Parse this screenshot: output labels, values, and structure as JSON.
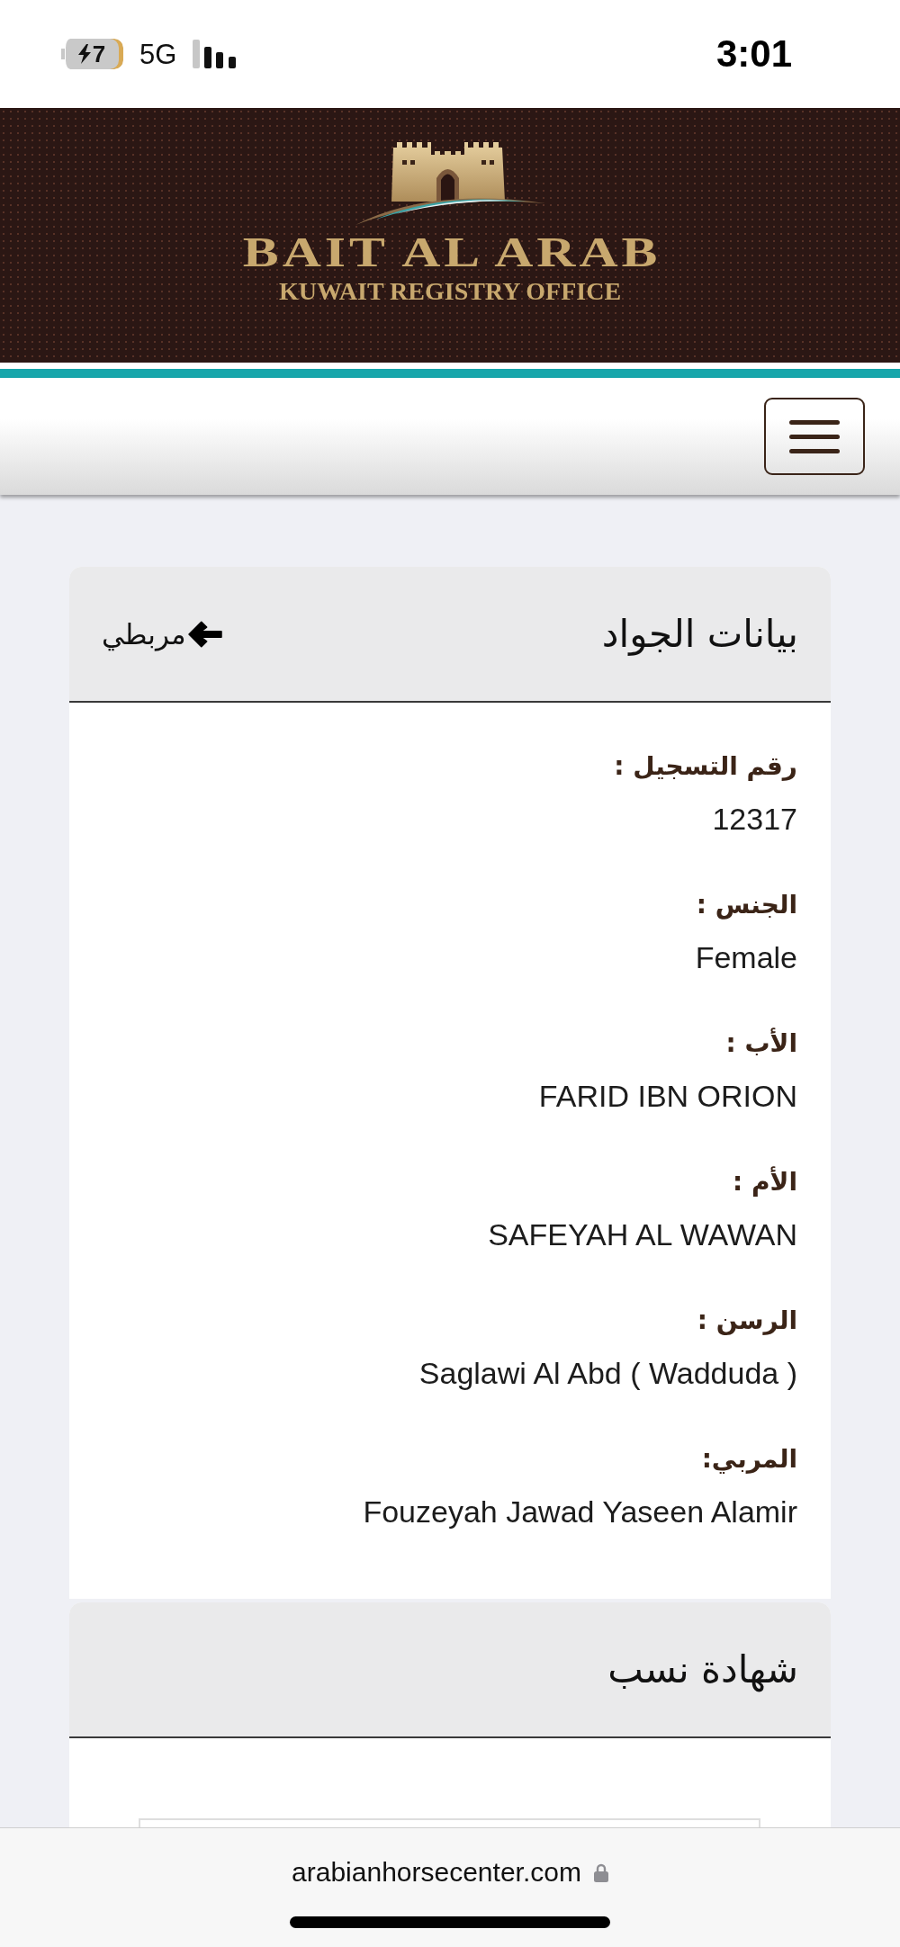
{
  "status_bar": {
    "battery": {
      "percent": "7",
      "charging": true
    },
    "network": "5G",
    "time": "3:01"
  },
  "header": {
    "title": "BAIT AL ARAB",
    "subtitle": "KUWAIT REGISTRY OFFICE"
  },
  "horse_card": {
    "title": "بيانات الجواد",
    "back_link": "مربطي",
    "fields": [
      {
        "label": "رقم التسجيل :",
        "value": "12317"
      },
      {
        "label": "الجنس :",
        "value": "Female"
      },
      {
        "label": "الأب :",
        "value": "FARID IBN ORION"
      },
      {
        "label": "الأم :",
        "value": "SAFEYAH AL WAWAN"
      },
      {
        "label": "الرسن :",
        "value": "Saglawi Al Abd ( Wadduda )"
      },
      {
        "label": "المربي:",
        "value": "Fouzeyah Jawad Yaseen Alamir"
      }
    ]
  },
  "pedigree_card": {
    "title": "شهادة نسب"
  },
  "browser_bar": {
    "url": "arabianhorsecenter.com"
  }
}
